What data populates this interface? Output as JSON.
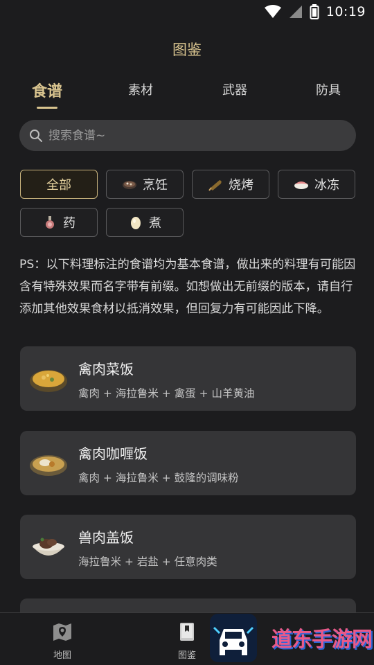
{
  "status_bar": {
    "time": "10:19"
  },
  "header": {
    "title": "图鉴"
  },
  "tabs": [
    {
      "label": "食谱",
      "active": true
    },
    {
      "label": "素材",
      "active": false
    },
    {
      "label": "武器",
      "active": false
    },
    {
      "label": "防具",
      "active": false
    }
  ],
  "search": {
    "placeholder": "搜索食谱~",
    "value": ""
  },
  "filters": [
    {
      "label": "全部",
      "icon": "none",
      "active": true
    },
    {
      "label": "烹饪",
      "icon": "cooking-pot-icon",
      "active": false
    },
    {
      "label": "烧烤",
      "icon": "grilled-fish-icon",
      "active": false
    },
    {
      "label": "冰冻",
      "icon": "sushi-icon",
      "active": false
    },
    {
      "label": "药",
      "icon": "potion-icon",
      "active": false
    },
    {
      "label": "煮",
      "icon": "egg-icon",
      "active": false
    }
  ],
  "note": "PS：以下料理标注的食谱均为基本食谱，做出来的料理有可能因含有特殊效果而名字带有前缀。如想做出无前缀的版本，请自行添加其他效果食材以抵消效果，但回复力有可能因此下降。",
  "recipes": [
    {
      "name": "禽肉菜饭",
      "ingredients": "禽肉 + 海拉鲁米 + 禽蛋 + 山羊黄油",
      "icon": "pilaf-dish-icon"
    },
    {
      "name": "禽肉咖喱饭",
      "ingredients": "禽肉 + 海拉鲁米 + 鼓隆的调味粉",
      "icon": "curry-dish-icon"
    },
    {
      "name": "兽肉盖饭",
      "ingredients": "海拉鲁米 + 岩盐 + 任意肉类",
      "icon": "meat-bowl-icon"
    }
  ],
  "bottom_nav": [
    {
      "label": "地图",
      "icon": "map-icon"
    },
    {
      "label": "图鉴",
      "icon": "book-icon"
    }
  ],
  "watermark": {
    "text": "道东手游网"
  },
  "colors": {
    "accent": "#d9c48f",
    "background": "#1c1c1e",
    "card": "#353537"
  }
}
